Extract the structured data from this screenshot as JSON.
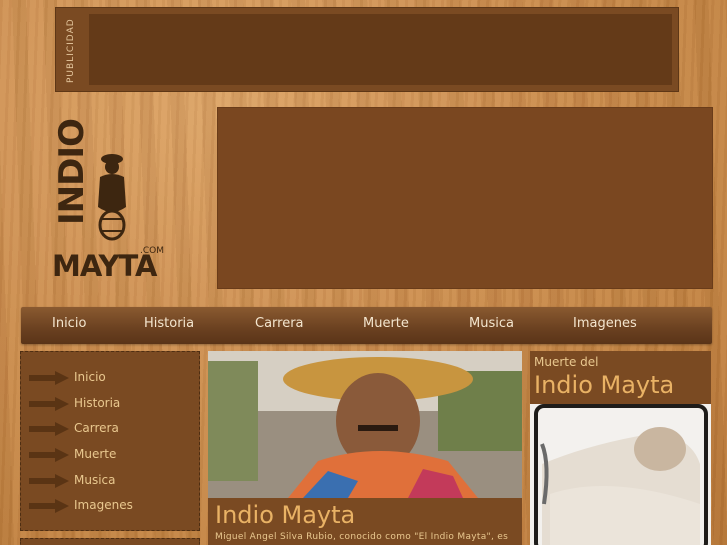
{
  "ad": {
    "label": "PUBLICIDAD"
  },
  "logo": {
    "word1": "INDIO",
    "word2": "MAYTA",
    "suffix": ".COM"
  },
  "nav": {
    "items": [
      {
        "label": "Inicio"
      },
      {
        "label": "Historia"
      },
      {
        "label": "Carrera"
      },
      {
        "label": "Muerte"
      },
      {
        "label": "Musica"
      },
      {
        "label": "Imagenes"
      }
    ]
  },
  "sidebar": {
    "items": [
      {
        "label": "Inicio"
      },
      {
        "label": "Historia"
      },
      {
        "label": "Carrera"
      },
      {
        "label": "Muerte"
      },
      {
        "label": "Musica"
      },
      {
        "label": "Imagenes"
      }
    ]
  },
  "feature": {
    "title": "Indio Mayta",
    "text": "Miguel Ángel Silva Rubio, conocido como \"El Indio Mayta\", es"
  },
  "death": {
    "pre_title": "Muerte del",
    "title": "Indio Mayta"
  },
  "colors": {
    "panel": "#7a4a22",
    "accent_text": "#e9b265",
    "nav_text": "#f4e6cf"
  }
}
